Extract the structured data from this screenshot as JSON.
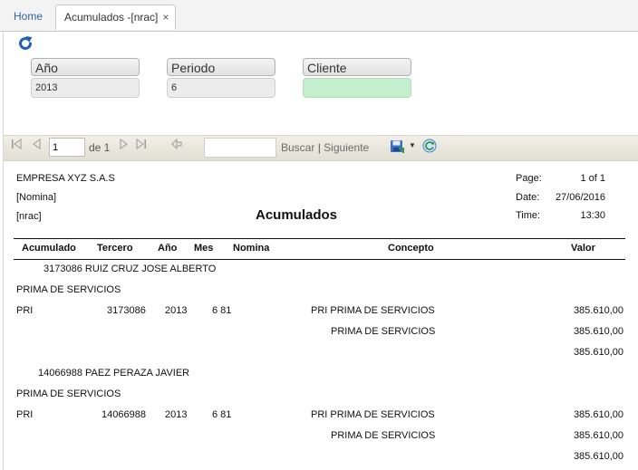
{
  "tabs": {
    "home": "Home",
    "active": "Acumulados -[nrac]",
    "close": "×"
  },
  "filters": {
    "anio_label": "Año",
    "anio_value": "2013",
    "periodo_label": "Periodo",
    "periodo_value": "6",
    "cliente_label": "Cliente",
    "cliente_value": ""
  },
  "toolbar": {
    "page_value": "1",
    "page_total": "de 1",
    "find_value": "",
    "buscar": "Buscar",
    "separator": "|",
    "siguiente": "Siguiente"
  },
  "report": {
    "company": "EMPRESA XYZ S.A.S",
    "module": "[Nomina]",
    "code": "[nrac]",
    "title": "Acumulados",
    "page_label": "Page:",
    "page_value": "1 of 1",
    "date_label": "Date:",
    "date_value": "27/06/2016",
    "time_label": "Time:",
    "time_value": "13:30",
    "columns": {
      "acumulado": "Acumulado",
      "tercero": "Tercero",
      "anio": "Año",
      "mes": "Mes",
      "nomina": "Nomina",
      "concepto": "Concepto",
      "valor": "Valor"
    },
    "groups": [
      {
        "employee": "3173086 RUIZ CRUZ JOSE ALBERTO",
        "concept_group": "PRIMA DE SERVICIOS",
        "row": {
          "acumulado": "PRI",
          "tercero": "3173086",
          "anio": "2013",
          "mes_nomina": "6 81",
          "concepto": "PRI PRIMA DE SERVICIOS",
          "valor": "385.610,00"
        },
        "subtotal_label": "PRIMA DE SERVICIOS",
        "subtotal_value": "385.610,00",
        "total_value": "385.610,00"
      },
      {
        "employee": "14066988 PAEZ PERAZA JAVIER",
        "concept_group": "PRIMA DE SERVICIOS",
        "row": {
          "acumulado": "PRI",
          "tercero": "14066988",
          "anio": "2013",
          "mes_nomina": "6 81",
          "concepto": "PRI PRIMA DE SERVICIOS",
          "valor": "385.610,00"
        },
        "subtotal_label": "PRIMA DE SERVICIOS",
        "subtotal_value": "385.610,00",
        "total_value": "385.610,00"
      }
    ]
  },
  "icons": {
    "refresh": "refresh-icon",
    "first": "first-page-icon",
    "prev": "previous-page-icon",
    "next": "next-page-icon",
    "last": "last-page-icon",
    "back": "back-to-parent-icon",
    "export": "save-export-icon",
    "dropdown": "dropdown-arrow-icon",
    "reload": "refresh-report-icon"
  },
  "colors": {
    "link": "#2e62a8",
    "cliente_field": "#c3efcd",
    "toolbar": "#e8e6dc"
  }
}
